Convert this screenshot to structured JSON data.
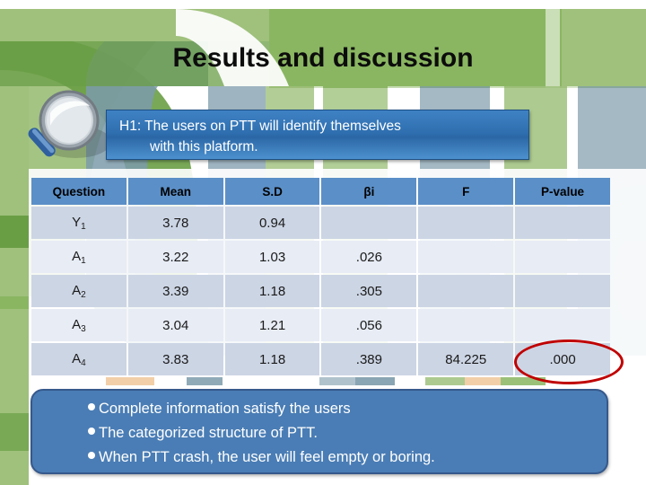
{
  "slide": {
    "title": "Results and discussion",
    "background_colors": {
      "green_light": "#9fc17c",
      "green_mid": "#8ab661",
      "green_dark": "#6a9e45",
      "blue_gray": "#7d9bab",
      "blue_gray_light": "#a7bcc7",
      "white": "#ffffff"
    }
  },
  "magnifier": {
    "icon": "magnifying-glass-icon",
    "lens_color": "#b9c1c7",
    "handle_color": "#3a6fae"
  },
  "callout": {
    "line1": "H1: The users on PTT will identify themselves",
    "line2": "with this platform.",
    "fill_color": "#2f6fb0",
    "border_color": "#1d4f85",
    "text_color": "#ffffff"
  },
  "table": {
    "header_color": "#5b8fc7",
    "band_a_color": "#ccd5e4",
    "band_b_color": "#e7ecf5",
    "columns": [
      "Question",
      "Mean",
      "S.D",
      "βi",
      "F",
      "P-value"
    ],
    "rows": [
      {
        "question": "Y",
        "sub": "1",
        "mean": "3.78",
        "sd": "0.94",
        "beta": "",
        "f": "",
        "p": ""
      },
      {
        "question": "A",
        "sub": "1",
        "mean": "3.22",
        "sd": "1.03",
        "beta": ".026",
        "f": "",
        "p": ""
      },
      {
        "question": "A",
        "sub": "2",
        "mean": "3.39",
        "sd": "1.18",
        "beta": ".305",
        "f": "",
        "p": ""
      },
      {
        "question": "A",
        "sub": "3",
        "mean": "3.04",
        "sd": "1.21",
        "beta": ".056",
        "f": "",
        "p": ""
      },
      {
        "question": "A",
        "sub": "4",
        "mean": "3.83",
        "sd": "1.18",
        "beta": ".389",
        "f": "84.225",
        "p": ".000"
      }
    ]
  },
  "highlight": {
    "target_value": ".000",
    "shape": "ellipse",
    "color": "#c00000"
  },
  "findings": {
    "fill_color": "#4a7db5",
    "border_color": "#36598c",
    "bullets": [
      "Complete information satisfy the users",
      "The categorized structure of PTT.",
      "When PTT crash, the user will feel empty or boring."
    ]
  }
}
